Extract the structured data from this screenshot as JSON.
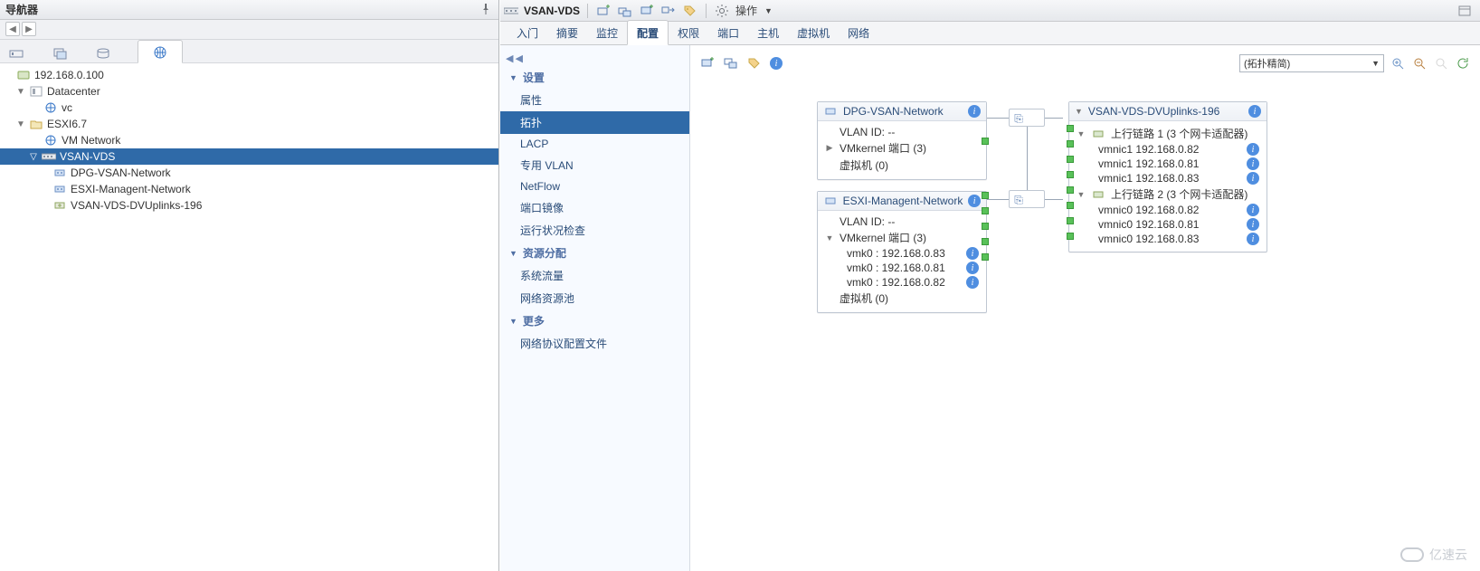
{
  "navigator": {
    "title": "导航器",
    "history": {
      "back": "◀",
      "fwd": "▶"
    },
    "tree": {
      "root_ip": "192.168.0.100",
      "datacenter": "Datacenter",
      "vc": "vc",
      "esxi": "ESXI6.7",
      "vm_network": "VM Network",
      "vsan_vds": "VSAN-VDS",
      "dpg": "DPG-VSAN-Network",
      "esxi_mgmt": "ESXI-Managent-Network",
      "dvuplinks": "VSAN-VDS-DVUplinks-196"
    }
  },
  "context": {
    "title": "VSAN-VDS",
    "actions_label": "操作"
  },
  "object_tabs": {
    "t0": "入门",
    "t1": "摘要",
    "t2": "监控",
    "t3": "配置",
    "t4": "权限",
    "t5": "端口",
    "t6": "主机",
    "t7": "虚拟机",
    "t8": "网络"
  },
  "config_side": {
    "group_settings": "设置",
    "items_settings": {
      "s0": "属性",
      "s1": "拓扑",
      "s2": "LACP",
      "s3": "专用 VLAN",
      "s4": "NetFlow",
      "s5": "端口镜像",
      "s6": "运行状况检查"
    },
    "group_resource": "资源分配",
    "items_resource": {
      "r0": "系统流量",
      "r1": "网络资源池"
    },
    "group_more": "更多",
    "items_more": {
      "m0": "网络协议配置文件"
    }
  },
  "cfg_toolbar": {
    "filter_value": "(拓扑精简)"
  },
  "topology": {
    "portgroups": [
      {
        "name": "DPG-VSAN-Network",
        "vlan_label": "VLAN ID: --",
        "vmk_label": "VMkernel 端口 (3)",
        "vm_label": "虚拟机 (0)",
        "vmk_items": []
      },
      {
        "name": "ESXI-Managent-Network",
        "vlan_label": "VLAN ID: --",
        "vmk_label": "VMkernel 端口 (3)",
        "vm_label": "虚拟机 (0)",
        "vmk_items": [
          "vmk0 : 192.168.0.83",
          "vmk0 : 192.168.0.81",
          "vmk0 : 192.168.0.82"
        ]
      }
    ],
    "uplinks": {
      "name": "VSAN-VDS-DVUplinks-196",
      "lag1_label": "上行链路 1 (3 个网卡适配器)",
      "lag1_items": [
        "vmnic1 192.168.0.82",
        "vmnic1 192.168.0.81",
        "vmnic1 192.168.0.83"
      ],
      "lag2_label": "上行链路 2 (3 个网卡适配器)",
      "lag2_items": [
        "vmnic0 192.168.0.82",
        "vmnic0 192.168.0.81",
        "vmnic0 192.168.0.83"
      ]
    }
  },
  "watermark": "亿速云"
}
